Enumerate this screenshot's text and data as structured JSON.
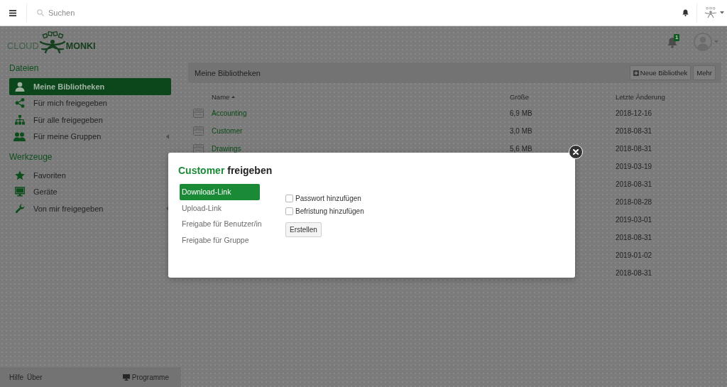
{
  "topbar": {
    "search": {
      "placeholder": "Suchen"
    }
  },
  "header": {
    "logo": {
      "first": "CLOUD",
      "second": "MONKI"
    },
    "notifications": {
      "count": "1"
    }
  },
  "sidebar": {
    "sections": [
      {
        "title": "Dateien",
        "items": [
          {
            "label": "Meine Bibliotheken",
            "selected": true
          },
          {
            "label": "Für mich freigegeben",
            "selected": false
          },
          {
            "label": "Für alle freigegeben",
            "selected": false
          },
          {
            "label": "Für meine Gruppen",
            "selected": false,
            "expanded": false
          }
        ]
      },
      {
        "title": "Werkzeuge",
        "items": [
          {
            "label": "Favoriten",
            "selected": false
          },
          {
            "label": "Geräte",
            "selected": false
          },
          {
            "label": "Von mir freigegeben",
            "selected": false,
            "expanded": false
          }
        ]
      }
    ],
    "footer": {
      "links": [
        "Hilfe",
        "Über"
      ],
      "programs": "Programme"
    }
  },
  "main": {
    "title": "Meine Bibliotheken",
    "buttons": [
      {
        "label": "Neue Bibliothek",
        "kind": "add"
      },
      {
        "label": "Mehr",
        "kind": "plain"
      }
    ],
    "table": {
      "columns": [
        {
          "label": "Name",
          "sorted": true
        },
        {
          "label": "Größe",
          "sorted": false
        },
        {
          "label": "Letzte Änderung",
          "sorted": false
        }
      ],
      "rows": [
        {
          "name": "Accounting",
          "size": "6,9 MB",
          "modified": "2018-12-16"
        },
        {
          "name": "Customer",
          "size": "3,0 MB",
          "modified": "2018-08-31"
        },
        {
          "name": "Drawings",
          "size": "5,6 MB",
          "modified": "2018-08-31"
        },
        {
          "modified": "2019-03-19"
        },
        {
          "modified": "2018-08-31"
        },
        {
          "modified": "2018-08-28"
        },
        {
          "modified": "2019-03-01"
        },
        {
          "modified": "2018-08-31"
        },
        {
          "modified": "2019-01-02"
        },
        {
          "modified": "2018-08-31"
        }
      ]
    }
  },
  "dialog": {
    "title": {
      "library": "Customer",
      "text": "freigeben"
    },
    "tabs": [
      {
        "label": "Download-Link",
        "selected": true
      },
      {
        "label": "Upload-Link",
        "selected": false
      },
      {
        "label": "Freigabe für Benutzer/in",
        "selected": false
      },
      {
        "label": "Freigabe für Gruppe",
        "selected": false
      }
    ],
    "options": [
      {
        "label": "Passwort hinzufügen",
        "checked": false
      },
      {
        "label": "Befristung hinzufügen",
        "checked": false
      }
    ],
    "submit": "Erstellen"
  }
}
